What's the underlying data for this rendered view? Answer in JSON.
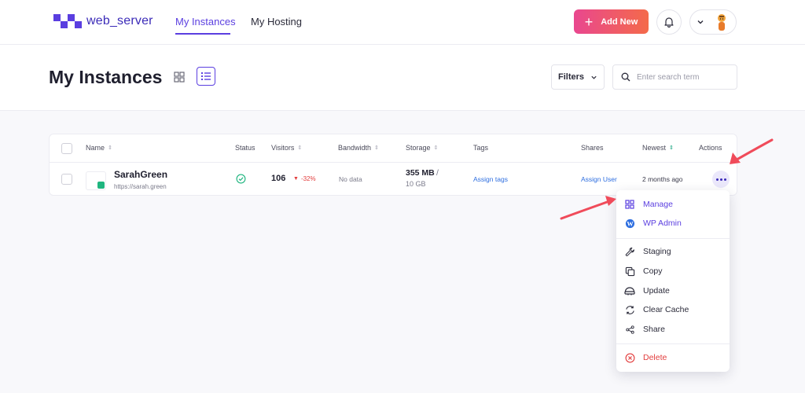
{
  "brand": {
    "name": "web_server"
  },
  "nav": {
    "tabs": [
      {
        "label": "My Instances",
        "active": true
      },
      {
        "label": "My Hosting",
        "active": false
      }
    ],
    "add_new_label": "Add New"
  },
  "header": {
    "title": "My Instances",
    "filters_label": "Filters",
    "search_placeholder": "Enter search term"
  },
  "table": {
    "columns": {
      "name": "Name",
      "status": "Status",
      "visitors": "Visitors",
      "bandwidth": "Bandwidth",
      "storage": "Storage",
      "tags": "Tags",
      "shares": "Shares",
      "newest": "Newest",
      "actions": "Actions"
    },
    "rows": [
      {
        "name": "SarahGreen",
        "url": "https://sarah.green",
        "visitors": "106",
        "visitors_change": "-32%",
        "bandwidth": "No data",
        "storage_used": "355 MB",
        "storage_sep": "/",
        "storage_total": "10 GB",
        "tags": "Assign tags",
        "shares": "Assign User",
        "newest": "2 months ago"
      }
    ]
  },
  "menu": {
    "items": [
      {
        "label": "Manage",
        "icon": "grid-icon"
      },
      {
        "label": "WP Admin",
        "icon": "wordpress-icon"
      },
      {
        "label": "Staging",
        "icon": "wrench-icon"
      },
      {
        "label": "Copy",
        "icon": "copy-icon"
      },
      {
        "label": "Update",
        "icon": "update-icon"
      },
      {
        "label": "Clear Cache",
        "icon": "refresh-icon"
      },
      {
        "label": "Share",
        "icon": "share-icon"
      },
      {
        "label": "Delete",
        "icon": "delete-icon"
      }
    ]
  },
  "colors": {
    "accent": "#5b3fe0",
    "link": "#2f6fe0",
    "danger": "#e23d3d",
    "success": "#1fb57f",
    "annotation": "#f04b5a"
  }
}
